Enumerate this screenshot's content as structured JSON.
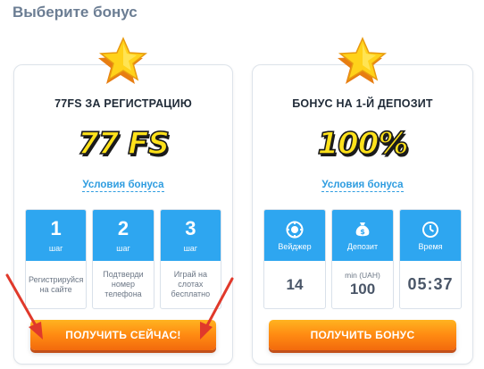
{
  "page": {
    "title": "Выберите бонус"
  },
  "cards": [
    {
      "title": "77FS ЗА РЕГИСТРАЦИЮ",
      "big_text": "77 FS",
      "conditions_link": "Условия бонуса",
      "steps": [
        {
          "number": "1",
          "word": "шаг",
          "text": "Регистрируйся на сайте"
        },
        {
          "number": "2",
          "word": "шаг",
          "text": "Подтверди номер телефона"
        },
        {
          "number": "3",
          "word": "шаг",
          "text": "Играй на слотах бесплатно"
        }
      ],
      "cta_label": "ПОЛУЧИТЬ СЕЙЧАС!"
    },
    {
      "title": "БОНУС НА 1-Й ДЕПОЗИТ",
      "big_text": "100%",
      "conditions_link": "Условия бонуса",
      "stats": [
        {
          "icon": "chip-icon",
          "label": "Вейджер",
          "caption": "",
          "value": "14"
        },
        {
          "icon": "money-bag-icon",
          "label": "Депозит",
          "caption": "min (UAH)",
          "value": "100"
        },
        {
          "icon": "clock-icon",
          "label": "Время",
          "caption": "",
          "value": "05:37"
        }
      ],
      "cta_label": "ПОЛУЧИТЬ БОНУС"
    }
  ],
  "colors": {
    "accent_blue": "#2ea6f0",
    "star_yellow": "#ffd21a",
    "cta_orange": "#ff8a12",
    "arrow_red": "#e0392b"
  }
}
